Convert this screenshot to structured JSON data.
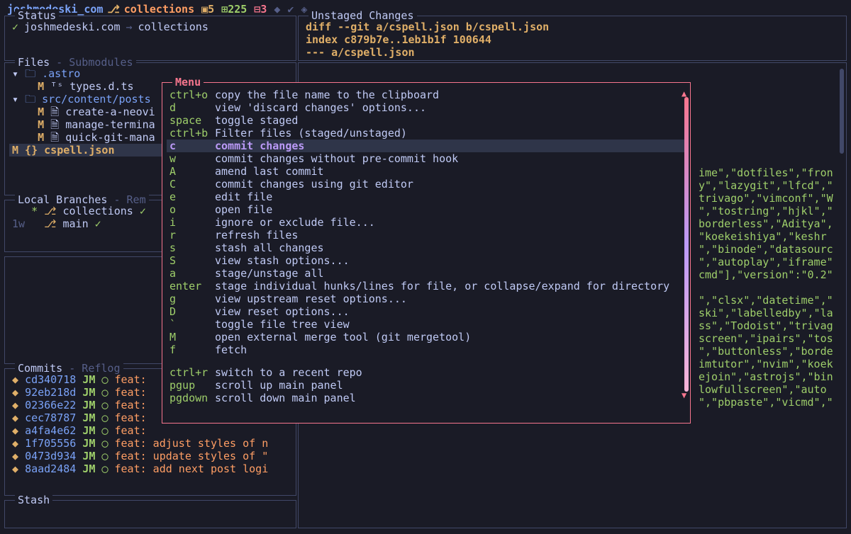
{
  "top": {
    "session": "joshmedeski_com",
    "branchword": "collections",
    "stat1": "5",
    "stat2": "225",
    "stat3": "3"
  },
  "status": {
    "title": "Status",
    "repo": "joshmedeski.com",
    "target": "collections"
  },
  "files": {
    "title": "Files",
    "title2": " - Submodules",
    "lines": [
      {
        "pre": "▾ ",
        "kind": "folder",
        "name": ".astro"
      },
      {
        "pre": "    M ᵀˢ ",
        "kind": "file",
        "name": "types.d.ts"
      },
      {
        "pre": "▾ ",
        "kind": "folder",
        "name": "src/content/posts"
      },
      {
        "pre": "    M 🗎 ",
        "kind": "file",
        "name": "create-a-neovi"
      },
      {
        "pre": "    M 🗎 ",
        "kind": "file",
        "name": "manage-termina"
      },
      {
        "pre": "    M 🗎 ",
        "kind": "file",
        "name": "quick-git-mana"
      }
    ],
    "selected": "  M {} cspell.json"
  },
  "branches": {
    "title": "Local Branches",
    "title2": " - Rem",
    "items": [
      {
        "ago": "  ",
        "star": "*",
        "name": "collections",
        "ok": true
      },
      {
        "ago": "1w",
        "star": " ",
        "name": "main",
        "ok": true
      }
    ]
  },
  "commits": {
    "title": "Commits",
    "title2": " - Reflog",
    "items": [
      {
        "hash": "cd340718",
        "jm": "JM",
        "msg": "feat:"
      },
      {
        "hash": "92eb218d",
        "jm": "JM",
        "msg": "feat:"
      },
      {
        "hash": "02366e22",
        "jm": "JM",
        "msg": "feat:"
      },
      {
        "hash": "cec78787",
        "jm": "JM",
        "msg": "feat:"
      },
      {
        "hash": "a4fa4e62",
        "jm": "JM",
        "msg": "feat:"
      },
      {
        "hash": "1f705556",
        "jm": "JM",
        "msg": "feat: adjust styles of n"
      },
      {
        "hash": "0473d934",
        "jm": "JM",
        "msg": "feat: update styles of \""
      },
      {
        "hash": "8aad2484",
        "jm": "JM",
        "msg": "feat: add next post logi"
      }
    ]
  },
  "stash": {
    "title": "Stash"
  },
  "unstaged": {
    "title": "Unstaged Changes",
    "lines": [
      "diff --git a/cspell.json b/cspell.json",
      "index c879b7e..1eb1b1f 100644",
      "--- a/cspell.json"
    ]
  },
  "menu": {
    "title": "Menu",
    "items": [
      {
        "key": "ctrl+o",
        "desc": "copy the file name to the clipboard"
      },
      {
        "key": "d",
        "desc": "view 'discard changes' options..."
      },
      {
        "key": "space",
        "desc": "toggle staged"
      },
      {
        "key": "ctrl+b",
        "desc": "Filter files (staged/unstaged)"
      },
      {
        "key": "c",
        "desc": "commit changes",
        "sel": true
      },
      {
        "key": "w",
        "desc": "commit changes without pre-commit hook"
      },
      {
        "key": "A",
        "desc": "amend last commit"
      },
      {
        "key": "C",
        "desc": "commit changes using git editor"
      },
      {
        "key": "e",
        "desc": "edit file"
      },
      {
        "key": "o",
        "desc": "open file"
      },
      {
        "key": "i",
        "desc": "ignore or exclude file..."
      },
      {
        "key": "r",
        "desc": "refresh files"
      },
      {
        "key": "s",
        "desc": "stash all changes"
      },
      {
        "key": "S",
        "desc": "view stash options..."
      },
      {
        "key": "a",
        "desc": "stage/unstage all"
      },
      {
        "key": "enter",
        "desc": "stage individual hunks/lines for file, or collapse/expand for directory"
      },
      {
        "key": "g",
        "desc": "view upstream reset options..."
      },
      {
        "key": "D",
        "desc": "view reset options..."
      },
      {
        "key": "`",
        "desc": "toggle file tree view"
      },
      {
        "key": "M",
        "desc": "open external merge tool (git mergetool)"
      },
      {
        "key": "f",
        "desc": "fetch"
      }
    ],
    "extra": [
      {
        "key": "ctrl+r",
        "desc": "switch to a recent repo"
      },
      {
        "key": "pgup",
        "desc": "scroll up main panel"
      },
      {
        "key": "pgdown",
        "desc": "scroll down main panel"
      }
    ]
  },
  "jsonfrag": {
    "lines": [
      "ime\",\"dotfiles\",\"fron",
      "y\",\"lazygit\",\"lfcd\",\"",
      "trivago\",\"vimconf\",\"W",
      "\",\"tostring\",\"hjkl\",\"",
      "borderless\",\"Aditya\",",
      "\"koekeishiya\",\"keshr",
      "\",\"binode\",\"datasourc",
      "\",\"autoplay\",\"iframe\",",
      "cmd\"],\"version\":\"0.2\"",
      "",
      "\",\"clsx\",\"datetime\",\"",
      "ski\",\"labelledby\",\"la",
      "ss\",\"Todoist\",\"trivag",
      "screen\",\"ipairs\",\"tos",
      "\",\"buttonless\",\"borde",
      "imtutor\",\"nvim\",\"koek",
      "ejoin\",\"astrojs\",\"bin",
      "lowfullscreen\",\"auto",
      "\",\"pbpaste\",\"vicmd\",\""
    ]
  }
}
